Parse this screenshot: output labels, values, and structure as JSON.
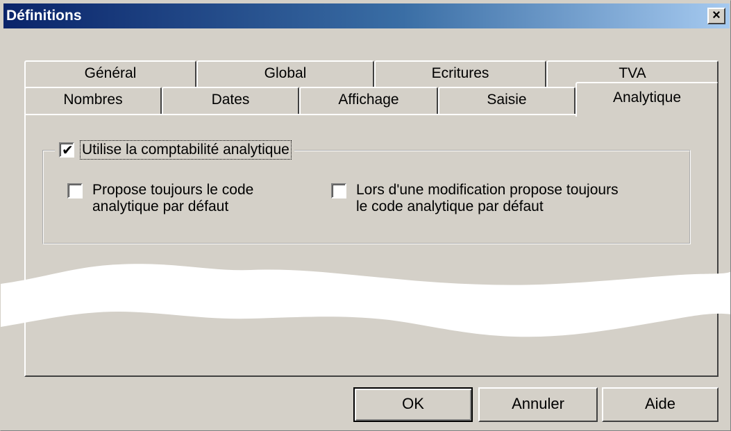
{
  "window": {
    "title": "Définitions",
    "close_glyph": "×"
  },
  "tabs": {
    "row1": [
      "Général",
      "Global",
      "Ecritures",
      "TVA"
    ],
    "row2": [
      "Nombres",
      "Dates",
      "Affichage",
      "Saisie",
      "Analytique"
    ],
    "active": "Analytique"
  },
  "analytique": {
    "group_label": "Utilise la comptabilité analytique",
    "group_checked": true,
    "check_glyph": "✔",
    "option1_line1": "Propose toujours le code",
    "option1_line2": "analytique par défaut",
    "option1_checked": false,
    "option2_line1": "Lors d'une modification propose toujours",
    "option2_line2": "le code analytique par défaut",
    "option2_checked": false
  },
  "buttons": {
    "ok": "OK",
    "cancel": "Annuler",
    "help": "Aide"
  },
  "colors": {
    "face": "#d4d0c8",
    "title_start": "#0a246a",
    "title_end": "#a6caf0"
  }
}
